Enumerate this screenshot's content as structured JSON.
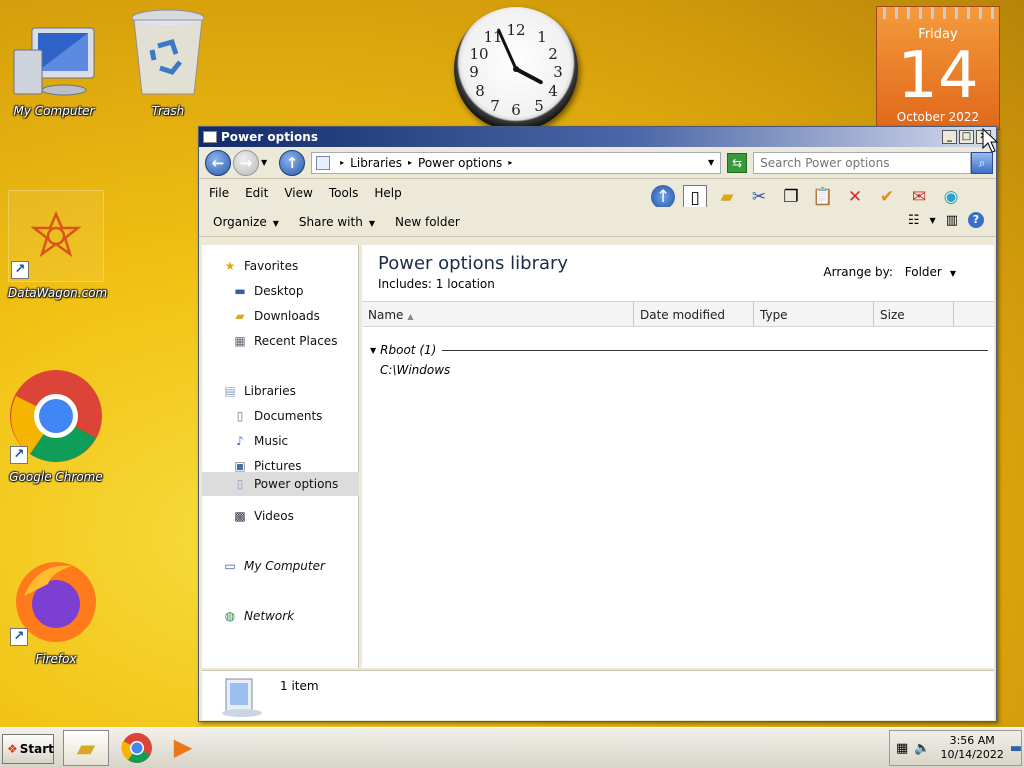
{
  "desktop": {
    "icons": [
      {
        "label": "My Computer"
      },
      {
        "label": "Trash"
      },
      {
        "label": "DataWagon.com"
      },
      {
        "label": "Google Chrome"
      },
      {
        "label": "Firefox"
      }
    ],
    "calendar": {
      "day": "Friday",
      "date": "14",
      "month": "October 2022"
    }
  },
  "window": {
    "title": "Power options",
    "breadcrumb": [
      "Libraries",
      "Power options"
    ],
    "search_placeholder": "Search Power options",
    "menu": [
      "File",
      "Edit",
      "View",
      "Tools",
      "Help"
    ],
    "commands": {
      "organize": "Organize",
      "share": "Share with",
      "new_folder": "New folder"
    },
    "nav": {
      "favorites": "Favorites",
      "desktop": "Desktop",
      "downloads": "Downloads",
      "recent": "Recent Places",
      "libraries": "Libraries",
      "documents": "Documents",
      "music": "Music",
      "pictures": "Pictures",
      "power_options": "Power options",
      "videos": "Videos",
      "my_computer": "My Computer",
      "network": "Network"
    },
    "library": {
      "title": "Power options library",
      "includes": "Includes:  1 location",
      "arrange_label": "Arrange by:",
      "arrange_value": "Folder"
    },
    "columns": [
      "Name",
      "Date modified",
      "Type",
      "Size"
    ],
    "group": {
      "label": "Rboot (1)"
    },
    "items": [
      {
        "name": "C:\\Windows"
      }
    ],
    "status": "1 item"
  },
  "taskbar": {
    "start": "Start",
    "time": "3:56 AM",
    "date": "10/14/2022"
  }
}
